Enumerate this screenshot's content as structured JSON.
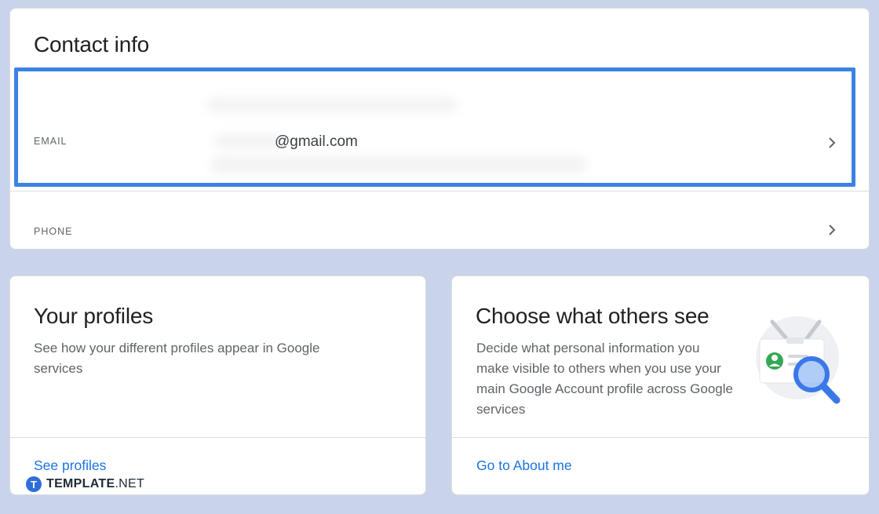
{
  "contact": {
    "title": "Contact info",
    "email": {
      "label": "EMAIL",
      "value": "@gmail.com"
    },
    "phone": {
      "label": "PHONE"
    }
  },
  "profiles": {
    "title": "Your profiles",
    "description": "See how your different profiles appear in Google services",
    "link": "See profiles"
  },
  "others": {
    "title": "Choose what others see",
    "description": "Decide what personal information you make visible to others when you use your main Google Account profile across Google services",
    "link": "Go to About me"
  },
  "watermark": {
    "brand": "TEMPLATE",
    "suffix": ".NET",
    "logo_letter": "T"
  },
  "colors": {
    "background": "#c9d3ea",
    "highlight": "#3b82e4",
    "link": "#1a73e8",
    "illustration_green": "#34a853",
    "illustration_blue": "#3b78e7"
  }
}
